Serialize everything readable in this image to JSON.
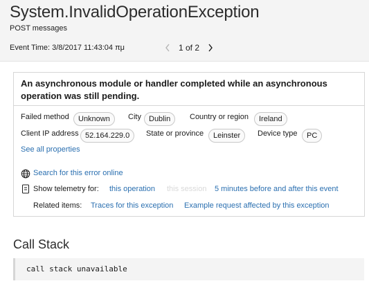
{
  "header": {
    "title": "System.InvalidOperationException",
    "subtitle": "POST messages",
    "event_time": "Event Time: 3/8/2017 11:43:04 πμ",
    "pager": "1 of 2",
    "prev_icon": "chevron-left-icon",
    "next_icon": "chevron-right-icon"
  },
  "detail": {
    "message": "An asynchronous module or handler completed while an asynchronous operation was still pending.",
    "properties": [
      {
        "label": "Failed method",
        "value": "Unknown"
      },
      {
        "label": "City",
        "value": "Dublin"
      },
      {
        "label": "Country or region",
        "value": "Ireland"
      },
      {
        "label": "Client IP address",
        "value": "52.164.229.0"
      },
      {
        "label": "State or province",
        "value": "Leinster"
      },
      {
        "label": "Device type",
        "value": "PC"
      }
    ],
    "see_all": "See all properties",
    "search_link": "Search for this error online",
    "search_icon": "globe-icon",
    "telemetry_label": "Show telemetry for:",
    "telemetry_icon": "telemetry-icon",
    "telemetry_options": [
      "this operation",
      "this session",
      "5 minutes before and after this event"
    ],
    "related_label": "Related items:",
    "related_links": [
      "Traces for this exception",
      "Example request affected by this exception"
    ]
  },
  "call_stack": {
    "title": "Call Stack",
    "content": "call stack unavailable"
  },
  "colors": {
    "link": "#2a6fb0",
    "header_bg": "#f4f4f4",
    "disabled_text": "#d9d9d9"
  }
}
